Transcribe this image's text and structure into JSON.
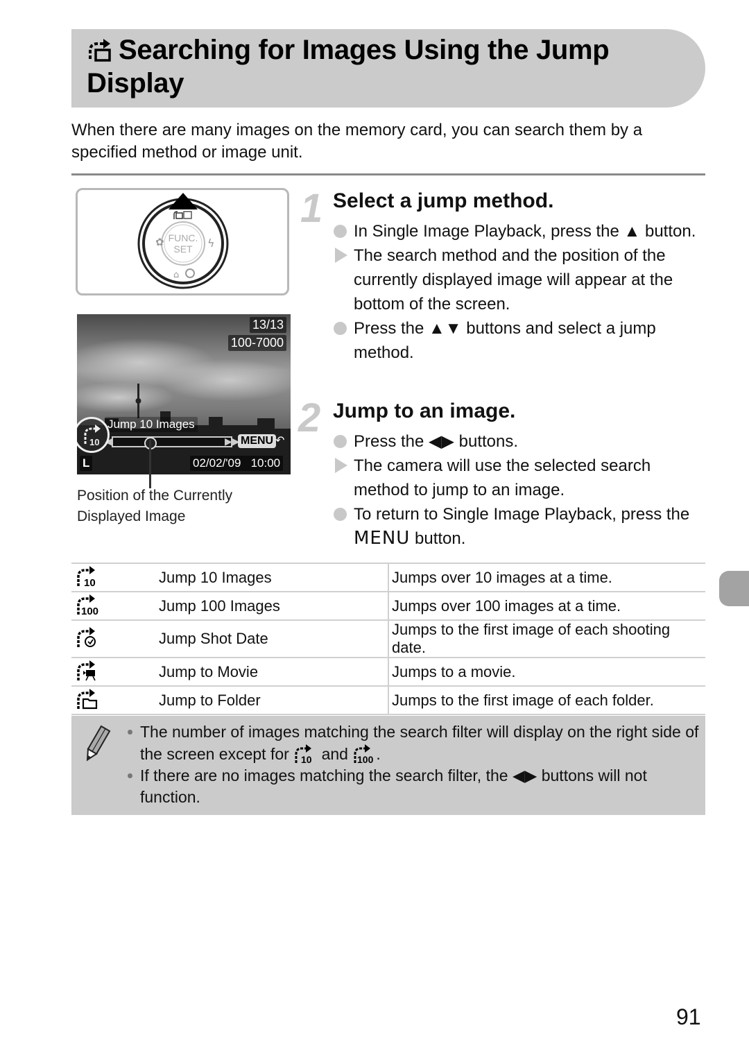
{
  "header": {
    "icon": "jump-icon",
    "title": "Searching for Images Using the Jump Display"
  },
  "intro": "When there are many images on the memory card, you can search them by a specified method or image unit.",
  "figure": {
    "dial": {
      "center_top": "FUNC.",
      "center_bottom": "SET",
      "pressed_direction": "up"
    },
    "screen": {
      "image_count": "13/13",
      "folder_file": "100-7000",
      "jump_mode_label": "Jump 10 Images",
      "menu_label": "MENU",
      "date": "02/02/'09",
      "time": "10:00",
      "size_label": "L",
      "jump_icon_number": "10"
    },
    "callout": "Position of the Currently Displayed Image"
  },
  "steps": [
    {
      "number": "1",
      "title": "Select a jump method.",
      "items": [
        {
          "type": "action",
          "text": "In Single Image Playback, press the ▲ button."
        },
        {
          "type": "result",
          "text": "The search method and the position of the currently displayed image will appear at the bottom of the screen."
        },
        {
          "type": "action",
          "text": "Press the ▲▼ buttons and select a jump method."
        }
      ]
    },
    {
      "number": "2",
      "title": "Jump to an image.",
      "items": [
        {
          "type": "action",
          "text": "Press the ◀▶ buttons."
        },
        {
          "type": "result",
          "text": "The camera will use the selected search method to jump to an image."
        },
        {
          "type": "action",
          "text_before": "To return to Single Image Playback, press the ",
          "menu": "MENU",
          "text_after": " button."
        }
      ]
    }
  ],
  "table": {
    "rows": [
      {
        "icon": "jump-10-icon",
        "icon_label": "10",
        "name": "Jump 10 Images",
        "description": "Jumps over 10 images at a time."
      },
      {
        "icon": "jump-100-icon",
        "icon_label": "100",
        "name": "Jump 100 Images",
        "description": "Jumps over 100 images at a time."
      },
      {
        "icon": "jump-shot-date-icon",
        "icon_label": "",
        "name": "Jump Shot Date",
        "description": "Jumps to the first image of each shooting date."
      },
      {
        "icon": "jump-movie-icon",
        "icon_label": "",
        "name": "Jump to Movie",
        "description": "Jumps to a movie."
      },
      {
        "icon": "jump-folder-icon",
        "icon_label": "",
        "name": "Jump to Folder",
        "description": "Jumps to the first image of each folder."
      }
    ]
  },
  "note": {
    "icon": "pencil-icon",
    "items": [
      {
        "text_before": "The number of images matching the search filter will display on the right side of the screen except for ",
        "and": " and ",
        "text_after": "."
      },
      {
        "text": "If there are no images matching the search filter, the ◀▶ buttons will not function."
      }
    ]
  },
  "page_number": "91",
  "colors": {
    "banner": "#cbcbcb",
    "note_bg": "#cbcbcb",
    "bullet": "#c8c8c8",
    "side_tab": "#a3a3a3"
  }
}
